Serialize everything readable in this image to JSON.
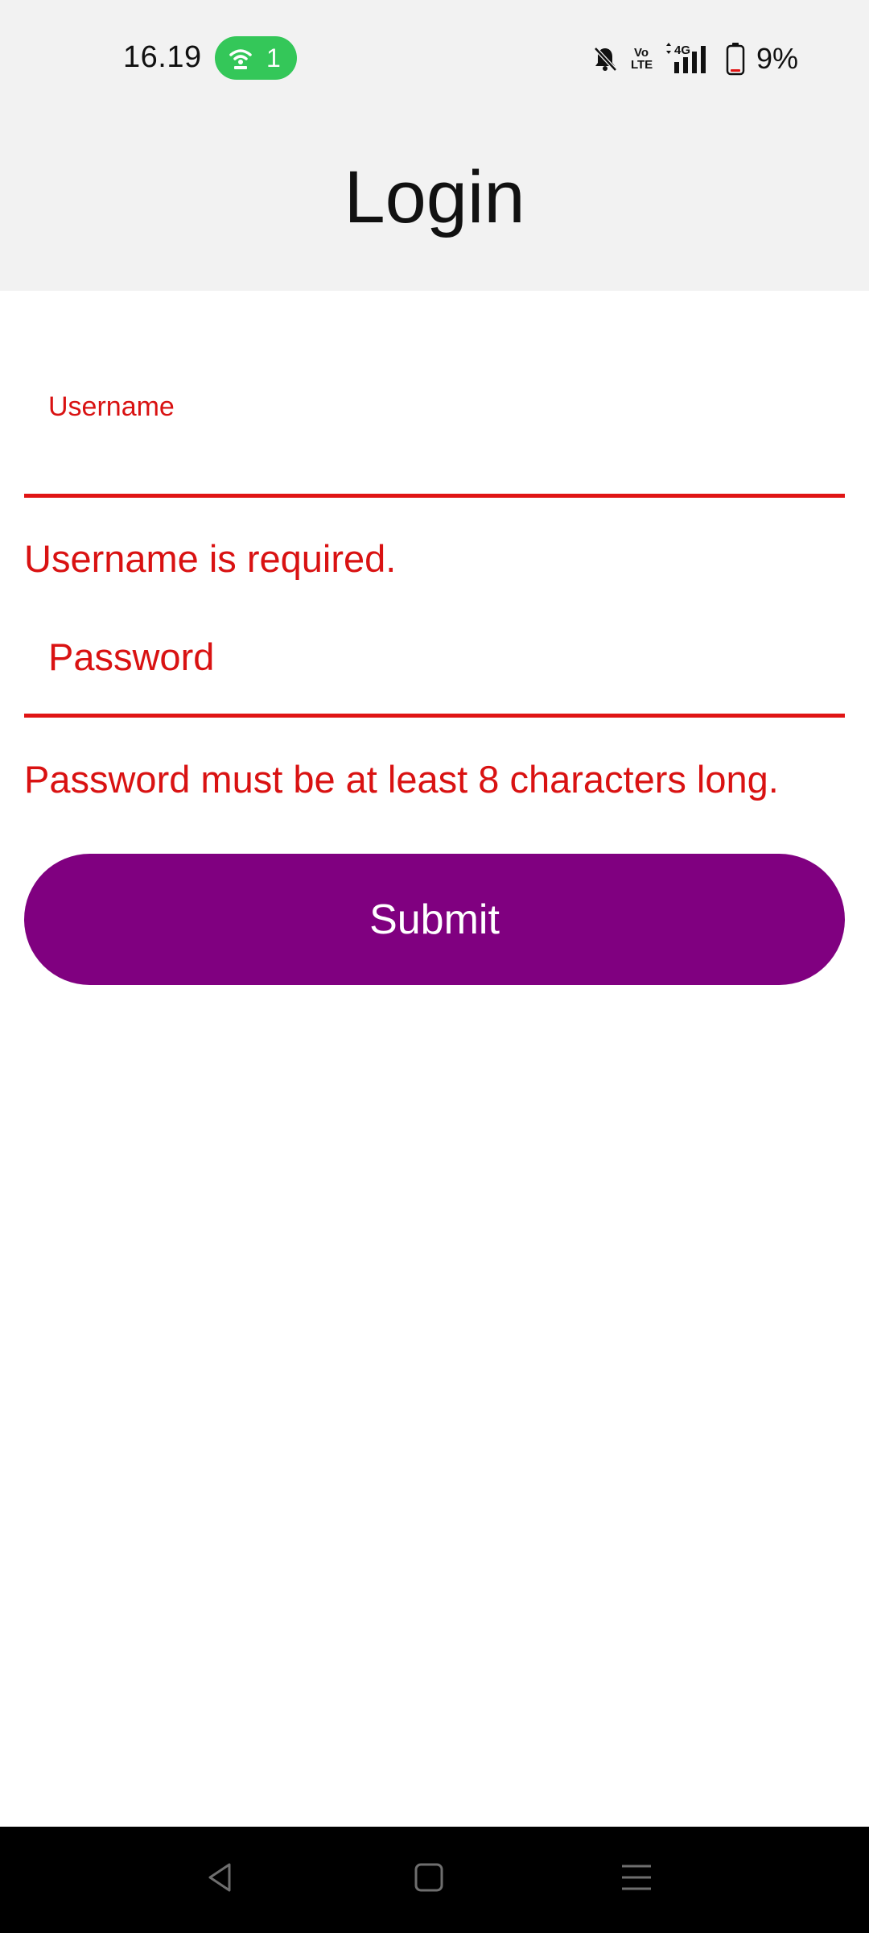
{
  "status_bar": {
    "time": "16.19",
    "hotspot_count": "1",
    "volte_label_top": "Vo",
    "volte_label_bottom": "LTE",
    "network_label": "4G",
    "battery_percent": "9%",
    "icons": [
      "wifi-hotspot-icon",
      "mute-bell-icon",
      "volte-icon",
      "signal-icon",
      "battery-icon"
    ]
  },
  "header": {
    "title": "Login"
  },
  "form": {
    "username": {
      "label": "Username",
      "value": "",
      "error": "Username is required."
    },
    "password": {
      "placeholder": "Password",
      "value": "",
      "error": "Password must be at least 8 characters long."
    },
    "submit_label": "Submit"
  },
  "colors": {
    "header_bg": "#f2f2f2",
    "error": "#d91212",
    "submit_bg": "#800080",
    "submit_text": "#ffffff",
    "hotspot_pill": "#34c759",
    "nav_bar_bg": "#000000"
  },
  "nav_bar": {
    "icons": [
      "back-icon",
      "home-icon",
      "recents-menu-icon"
    ]
  }
}
